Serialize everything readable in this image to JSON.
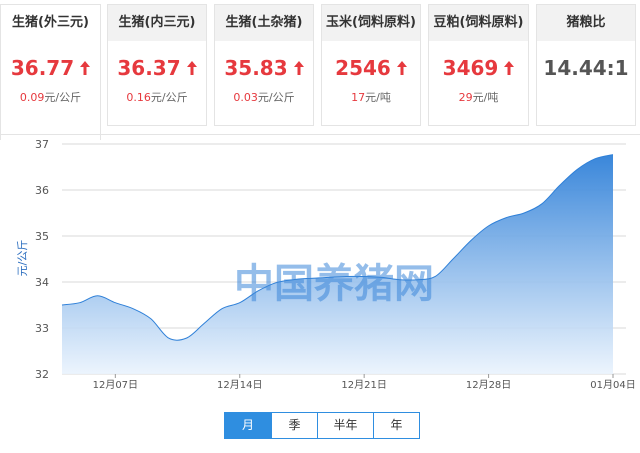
{
  "cards": [
    {
      "title": "生猪(外三元)",
      "price": "36.77",
      "change_value": "0.09",
      "change_unit": "元/公斤",
      "trend": "up"
    },
    {
      "title": "生猪(内三元)",
      "price": "36.37",
      "change_value": "0.16",
      "change_unit": "元/公斤",
      "trend": "up"
    },
    {
      "title": "生猪(土杂猪)",
      "price": "35.83",
      "change_value": "0.03",
      "change_unit": "元/公斤",
      "trend": "up"
    },
    {
      "title": "玉米(饲料原料)",
      "price": "2546",
      "change_value": "17",
      "change_unit": "元/吨",
      "trend": "up"
    },
    {
      "title": "豆粕(饲料原料)",
      "price": "3469",
      "change_value": "29",
      "change_unit": "元/吨",
      "trend": "up"
    },
    {
      "title": "猪粮比",
      "price": "14.44:1",
      "change_value": "",
      "change_unit": "",
      "trend": "none"
    }
  ],
  "colors": {
    "up": "#e6393e",
    "area_top": "#2f80d8",
    "area_bottom": "#eaf3fd",
    "tab_active": "#2f8ee0"
  },
  "watermark": "中国养猪网",
  "chart_data": {
    "type": "area",
    "title": "",
    "xlabel": "",
    "ylabel": "元/公斤",
    "ylim": [
      32,
      37
    ],
    "yticks": [
      32,
      33,
      34,
      35,
      36,
      37
    ],
    "x_tick_labels": [
      "12月07日",
      "12月14日",
      "12月21日",
      "12月28日",
      "01月04日"
    ],
    "x_tick_days": [
      4,
      11,
      18,
      25,
      32
    ],
    "grid": true,
    "series": [
      {
        "name": "",
        "x": [
          1,
          2,
          3,
          4,
          5,
          6,
          7,
          8,
          9,
          10,
          11,
          12,
          13,
          14,
          15,
          16,
          17,
          18,
          19,
          20,
          21,
          22,
          23,
          24,
          25,
          26,
          27,
          28,
          29,
          30,
          31,
          32
        ],
        "values": [
          33.5,
          33.55,
          33.7,
          33.55,
          33.42,
          33.2,
          32.78,
          32.78,
          33.1,
          33.42,
          33.55,
          33.8,
          33.98,
          34.05,
          34.08,
          34.1,
          34.12,
          34.12,
          34.1,
          34.05,
          34.05,
          34.12,
          34.5,
          34.9,
          35.22,
          35.4,
          35.5,
          35.7,
          36.1,
          36.45,
          36.68,
          36.77
        ]
      }
    ]
  },
  "period_tabs": [
    "月",
    "季",
    "半年",
    "年"
  ],
  "period_selected": 0
}
